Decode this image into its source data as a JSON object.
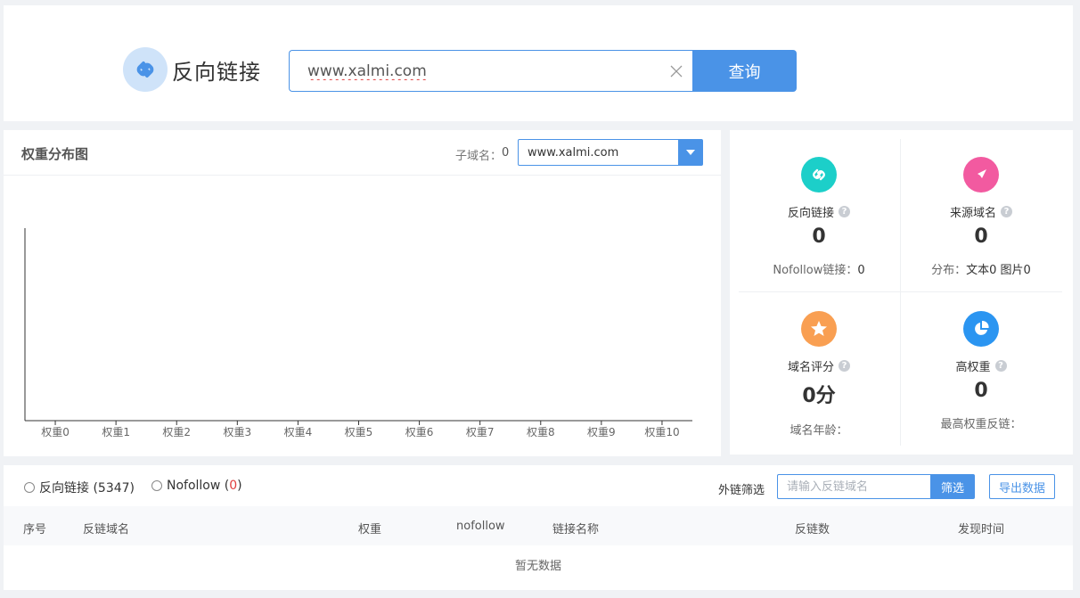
{
  "search": {
    "title": "反向链接",
    "input_value": "www.xalmi.com",
    "button_label": "查询"
  },
  "chart_panel": {
    "title": "权重分布图",
    "subdomain_label": "子域名：",
    "subdomain_count": "0",
    "selected_domain": "www.xalmi.com"
  },
  "chart_data": {
    "type": "bar",
    "categories": [
      "权重0",
      "权重1",
      "权重2",
      "权重3",
      "权重4",
      "权重5",
      "权重6",
      "权重7",
      "权重8",
      "权重9",
      "权重10"
    ],
    "values": [
      0,
      0,
      0,
      0,
      0,
      0,
      0,
      0,
      0,
      0,
      0
    ],
    "title": "",
    "xlabel": "",
    "ylabel": "",
    "grid": false
  },
  "stats": {
    "backlinks": {
      "label": "反向链接",
      "value": "0",
      "sub_label": "Nofollow链接：",
      "sub_value": "0",
      "color": "#1ccfc9",
      "icon": "link-icon"
    },
    "source_domains": {
      "label": "来源域名",
      "value": "0",
      "sub_label": "分布：",
      "sub_value": "文本0 图片0",
      "color": "#f25aa0",
      "icon": "compass-icon"
    },
    "domain_score": {
      "label": "域名评分",
      "value": "0分",
      "sub_label": "域名年龄：",
      "sub_value": "",
      "color": "#f99f52",
      "icon": "star-icon"
    },
    "high_weight": {
      "label": "高权重",
      "value": "0",
      "sub_label": "最高权重反链：",
      "sub_value": "",
      "color": "#2b95f1",
      "icon": "pie-chart-icon"
    }
  },
  "table_panel": {
    "radio_backlinks_label": "反向链接 (5347)",
    "radio_nofollow_label": "Nofollow (",
    "radio_nofollow_count": "0",
    "radio_nofollow_close": ")",
    "filter_label": "外链筛选",
    "filter_placeholder": "请输入反链域名",
    "filter_button": "筛选",
    "export_button": "导出数据",
    "columns": [
      "序号",
      "反链域名",
      "权重",
      "nofollow",
      "链接名称",
      "反链数",
      "发现时间"
    ],
    "empty_text": "暂无数据"
  },
  "colors": {
    "accent": "#4a93e7",
    "background": "#f0f2f5"
  }
}
